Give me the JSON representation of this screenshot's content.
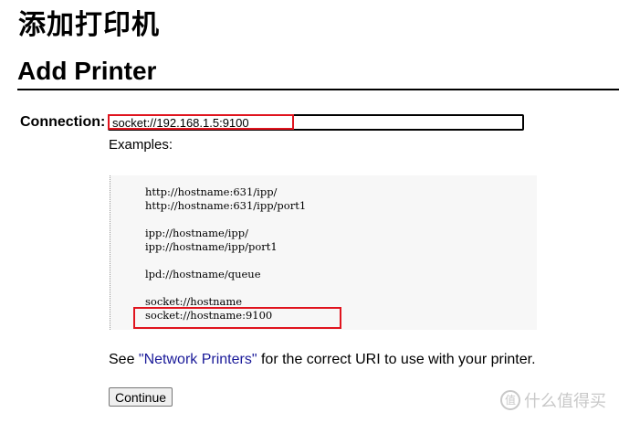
{
  "page": {
    "title_cn": "添加打印机",
    "title_en": "Add Printer"
  },
  "form": {
    "connection_label": "Connection:",
    "connection_value": "socket://192.168.1.5:9100",
    "examples_label": "Examples:",
    "examples": [
      "http://hostname:631/ipp/",
      "http://hostname:631/ipp/port1",
      "",
      "ipp://hostname/ipp/",
      "ipp://hostname/ipp/port1",
      "",
      "lpd://hostname/queue",
      "",
      "socket://hostname",
      "socket://hostname:9100"
    ],
    "see_prefix": "See ",
    "see_link": "\"Network Printers\"",
    "see_suffix": " for the correct URI to use with your printer.",
    "continue_label": "Continue"
  },
  "watermark": {
    "text": "什么值得买",
    "icon_glyph": "值"
  },
  "colors": {
    "highlight": "#e0141e",
    "link": "#1a1a99",
    "code_bg": "#f7f7f7"
  }
}
